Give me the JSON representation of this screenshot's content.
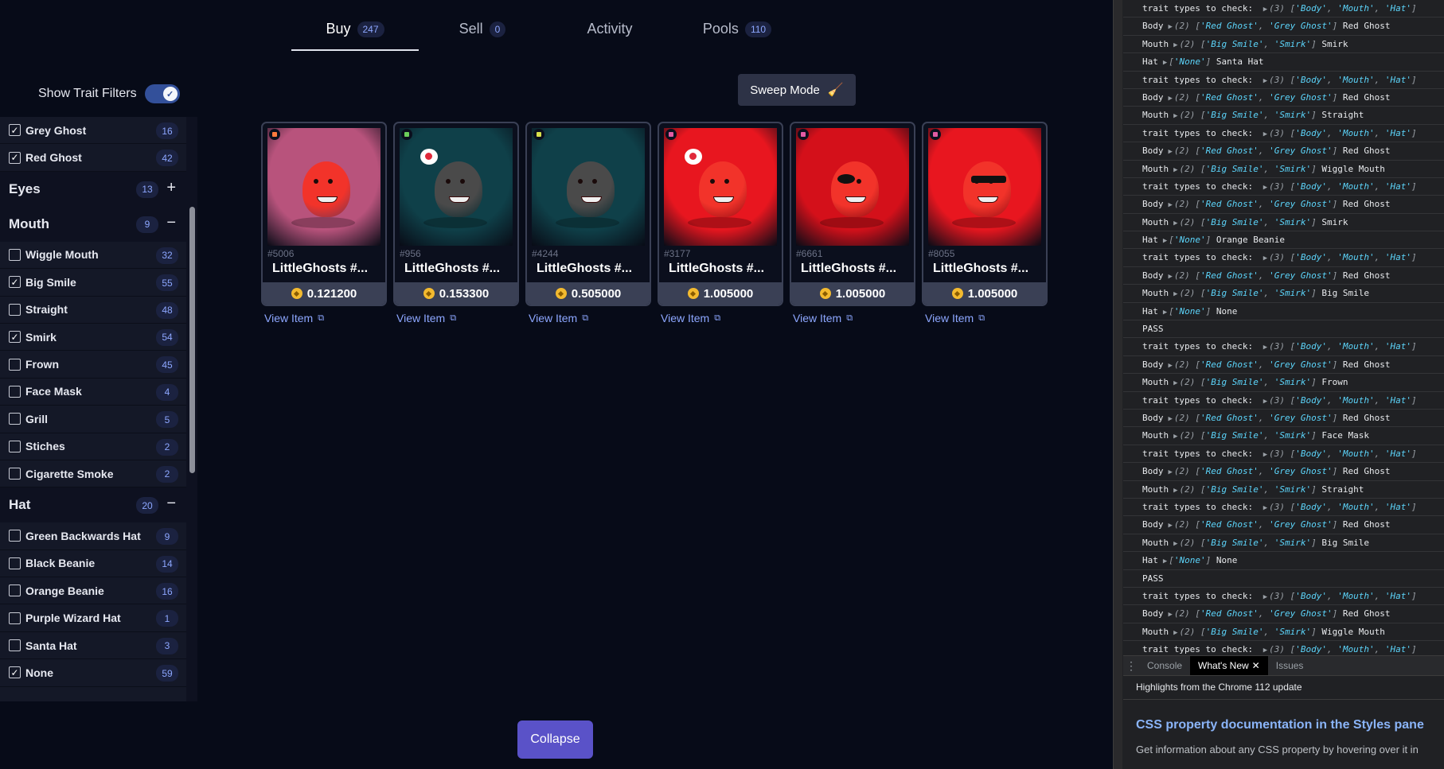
{
  "tabs": [
    {
      "label": "Buy",
      "count": "247"
    },
    {
      "label": "Sell",
      "count": "0"
    },
    {
      "label": "Activity",
      "count": ""
    },
    {
      "label": "Pools",
      "count": "110"
    }
  ],
  "filters": {
    "toggle_label": "Show Trait Filters",
    "toggle_on": true,
    "body_items": [
      {
        "label": "Grey Ghost",
        "count": "16",
        "checked": true
      },
      {
        "label": "Red Ghost",
        "count": "42",
        "checked": true
      }
    ],
    "eyes": {
      "label": "Eyes",
      "count": "13",
      "sign": "+"
    },
    "mouth": {
      "label": "Mouth",
      "count": "9",
      "sign": "−"
    },
    "mouth_items": [
      {
        "label": "Wiggle Mouth",
        "count": "32",
        "checked": false
      },
      {
        "label": "Big Smile",
        "count": "55",
        "checked": true
      },
      {
        "label": "Straight",
        "count": "48",
        "checked": false
      },
      {
        "label": "Smirk",
        "count": "54",
        "checked": true
      },
      {
        "label": "Frown",
        "count": "45",
        "checked": false
      },
      {
        "label": "Face Mask",
        "count": "4",
        "checked": false
      },
      {
        "label": "Grill",
        "count": "5",
        "checked": false
      },
      {
        "label": "Stiches",
        "count": "2",
        "checked": false
      },
      {
        "label": "Cigarette Smoke",
        "count": "2",
        "checked": false
      }
    ],
    "hat": {
      "label": "Hat",
      "count": "20",
      "sign": "−"
    },
    "hat_items": [
      {
        "label": "Green Backwards Hat",
        "count": "9",
        "checked": false
      },
      {
        "label": "Black Beanie",
        "count": "14",
        "checked": false
      },
      {
        "label": "Orange Beanie",
        "count": "16",
        "checked": false
      },
      {
        "label": "Purple Wizard Hat",
        "count": "1",
        "checked": false
      },
      {
        "label": "Santa Hat",
        "count": "3",
        "checked": false
      },
      {
        "label": "None",
        "count": "59",
        "checked": true
      }
    ]
  },
  "sweep": {
    "label": "Sweep Mode",
    "icon": "broom-icon"
  },
  "cards": [
    {
      "id": "#5006",
      "name": "LittleGhosts #...",
      "price": "0.121200",
      "link": "View Item",
      "bg": "#b8537c",
      "ghost": "#f2332a",
      "tag": "#ff7a3d",
      "extra": "none"
    },
    {
      "id": "#956",
      "name": "LittleGhosts #...",
      "price": "0.153300",
      "link": "View Item",
      "bg": "#0f4049",
      "ghost": "#4a4a4a",
      "tag": "#6ccf5a",
      "extra": "bubble"
    },
    {
      "id": "#4244",
      "name": "LittleGhosts #...",
      "price": "0.505000",
      "link": "View Item",
      "bg": "#0f4049",
      "ghost": "#4a4a4a",
      "tag": "#d8e04a",
      "extra": "none"
    },
    {
      "id": "#3177",
      "name": "LittleGhosts #...",
      "price": "1.005000",
      "link": "View Item",
      "bg": "#e8161f",
      "ghost": "#f2332a",
      "tag": "#e25ca3",
      "extra": "bubble"
    },
    {
      "id": "#6661",
      "name": "LittleGhosts #...",
      "price": "1.005000",
      "link": "View Item",
      "bg": "#d4101a",
      "ghost": "#f2332a",
      "tag": "#e25ca3",
      "extra": "eyepatch"
    },
    {
      "id": "#8055",
      "name": "LittleGhosts #...",
      "price": "1.005000",
      "link": "View Item",
      "bg": "#e8161f",
      "ghost": "#f2332a",
      "tag": "#e25ca3",
      "extra": "shades"
    }
  ],
  "collapse_label": "Collapse",
  "console": {
    "lines": [
      {
        "type": "check",
        "key": "trait types to check: ",
        "count": "(3)",
        "items": [
          "'Body'",
          "'Mouth'",
          "'Hat'"
        ],
        "value": ""
      },
      {
        "type": "arr",
        "key": "Body",
        "count": "(2)",
        "items": [
          "'Red Ghost'",
          "'Grey Ghost'"
        ],
        "value": "Red Ghost"
      },
      {
        "type": "arr",
        "key": "Mouth",
        "count": "(2)",
        "items": [
          "'Big Smile'",
          "'Smirk'"
        ],
        "value": "Smirk"
      },
      {
        "type": "arr",
        "key": "Hat",
        "count": "",
        "items": [
          "'None'"
        ],
        "value": "Santa Hat"
      },
      {
        "type": "check",
        "key": "trait types to check: ",
        "count": "(3)",
        "items": [
          "'Body'",
          "'Mouth'",
          "'Hat'"
        ],
        "value": ""
      },
      {
        "type": "arr",
        "key": "Body",
        "count": "(2)",
        "items": [
          "'Red Ghost'",
          "'Grey Ghost'"
        ],
        "value": "Red Ghost"
      },
      {
        "type": "arr",
        "key": "Mouth",
        "count": "(2)",
        "items": [
          "'Big Smile'",
          "'Smirk'"
        ],
        "value": "Straight"
      },
      {
        "type": "check",
        "key": "trait types to check: ",
        "count": "(3)",
        "items": [
          "'Body'",
          "'Mouth'",
          "'Hat'"
        ],
        "value": ""
      },
      {
        "type": "arr",
        "key": "Body",
        "count": "(2)",
        "items": [
          "'Red Ghost'",
          "'Grey Ghost'"
        ],
        "value": "Red Ghost"
      },
      {
        "type": "arr",
        "key": "Mouth",
        "count": "(2)",
        "items": [
          "'Big Smile'",
          "'Smirk'"
        ],
        "value": "Wiggle Mouth"
      },
      {
        "type": "check",
        "key": "trait types to check: ",
        "count": "(3)",
        "items": [
          "'Body'",
          "'Mouth'",
          "'Hat'"
        ],
        "value": ""
      },
      {
        "type": "arr",
        "key": "Body",
        "count": "(2)",
        "items": [
          "'Red Ghost'",
          "'Grey Ghost'"
        ],
        "value": "Red Ghost"
      },
      {
        "type": "arr",
        "key": "Mouth",
        "count": "(2)",
        "items": [
          "'Big Smile'",
          "'Smirk'"
        ],
        "value": "Smirk"
      },
      {
        "type": "arr",
        "key": "Hat",
        "count": "",
        "items": [
          "'None'"
        ],
        "value": "Orange Beanie"
      },
      {
        "type": "check",
        "key": "trait types to check: ",
        "count": "(3)",
        "items": [
          "'Body'",
          "'Mouth'",
          "'Hat'"
        ],
        "value": ""
      },
      {
        "type": "arr",
        "key": "Body",
        "count": "(2)",
        "items": [
          "'Red Ghost'",
          "'Grey Ghost'"
        ],
        "value": "Red Ghost"
      },
      {
        "type": "arr",
        "key": "Mouth",
        "count": "(2)",
        "items": [
          "'Big Smile'",
          "'Smirk'"
        ],
        "value": "Big Smile"
      },
      {
        "type": "arr",
        "key": "Hat",
        "count": "",
        "items": [
          "'None'"
        ],
        "value": "None"
      },
      {
        "type": "plain",
        "key": "PASS",
        "count": "",
        "items": [],
        "value": ""
      },
      {
        "type": "check",
        "key": "trait types to check: ",
        "count": "(3)",
        "items": [
          "'Body'",
          "'Mouth'",
          "'Hat'"
        ],
        "value": ""
      },
      {
        "type": "arr",
        "key": "Body",
        "count": "(2)",
        "items": [
          "'Red Ghost'",
          "'Grey Ghost'"
        ],
        "value": "Red Ghost"
      },
      {
        "type": "arr",
        "key": "Mouth",
        "count": "(2)",
        "items": [
          "'Big Smile'",
          "'Smirk'"
        ],
        "value": "Frown"
      },
      {
        "type": "check",
        "key": "trait types to check: ",
        "count": "(3)",
        "items": [
          "'Body'",
          "'Mouth'",
          "'Hat'"
        ],
        "value": ""
      },
      {
        "type": "arr",
        "key": "Body",
        "count": "(2)",
        "items": [
          "'Red Ghost'",
          "'Grey Ghost'"
        ],
        "value": "Red Ghost"
      },
      {
        "type": "arr",
        "key": "Mouth",
        "count": "(2)",
        "items": [
          "'Big Smile'",
          "'Smirk'"
        ],
        "value": "Face Mask"
      },
      {
        "type": "check",
        "key": "trait types to check: ",
        "count": "(3)",
        "items": [
          "'Body'",
          "'Mouth'",
          "'Hat'"
        ],
        "value": ""
      },
      {
        "type": "arr",
        "key": "Body",
        "count": "(2)",
        "items": [
          "'Red Ghost'",
          "'Grey Ghost'"
        ],
        "value": "Red Ghost"
      },
      {
        "type": "arr",
        "key": "Mouth",
        "count": "(2)",
        "items": [
          "'Big Smile'",
          "'Smirk'"
        ],
        "value": "Straight"
      },
      {
        "type": "check",
        "key": "trait types to check: ",
        "count": "(3)",
        "items": [
          "'Body'",
          "'Mouth'",
          "'Hat'"
        ],
        "value": ""
      },
      {
        "type": "arr",
        "key": "Body",
        "count": "(2)",
        "items": [
          "'Red Ghost'",
          "'Grey Ghost'"
        ],
        "value": "Red Ghost"
      },
      {
        "type": "arr",
        "key": "Mouth",
        "count": "(2)",
        "items": [
          "'Big Smile'",
          "'Smirk'"
        ],
        "value": "Big Smile"
      },
      {
        "type": "arr",
        "key": "Hat",
        "count": "",
        "items": [
          "'None'"
        ],
        "value": "None"
      },
      {
        "type": "plain",
        "key": "PASS",
        "count": "",
        "items": [],
        "value": ""
      },
      {
        "type": "check",
        "key": "trait types to check: ",
        "count": "(3)",
        "items": [
          "'Body'",
          "'Mouth'",
          "'Hat'"
        ],
        "value": ""
      },
      {
        "type": "arr",
        "key": "Body",
        "count": "(2)",
        "items": [
          "'Red Ghost'",
          "'Grey Ghost'"
        ],
        "value": "Red Ghost"
      },
      {
        "type": "arr",
        "key": "Mouth",
        "count": "(2)",
        "items": [
          "'Big Smile'",
          "'Smirk'"
        ],
        "value": "Wiggle Mouth"
      },
      {
        "type": "check",
        "key": "trait types to check: ",
        "count": "(3)",
        "items": [
          "'Body'",
          "'Mouth'",
          "'Hat'"
        ],
        "value": ""
      }
    ],
    "tabs": [
      {
        "label": "Console",
        "active": false
      },
      {
        "label": "What's New",
        "active": true
      },
      {
        "label": "Issues",
        "active": false
      }
    ],
    "highlights": "Highlights from the Chrome 112 update",
    "heading": "CSS property documentation in the Styles pane",
    "text": "Get information about any CSS property by hovering over it in"
  }
}
